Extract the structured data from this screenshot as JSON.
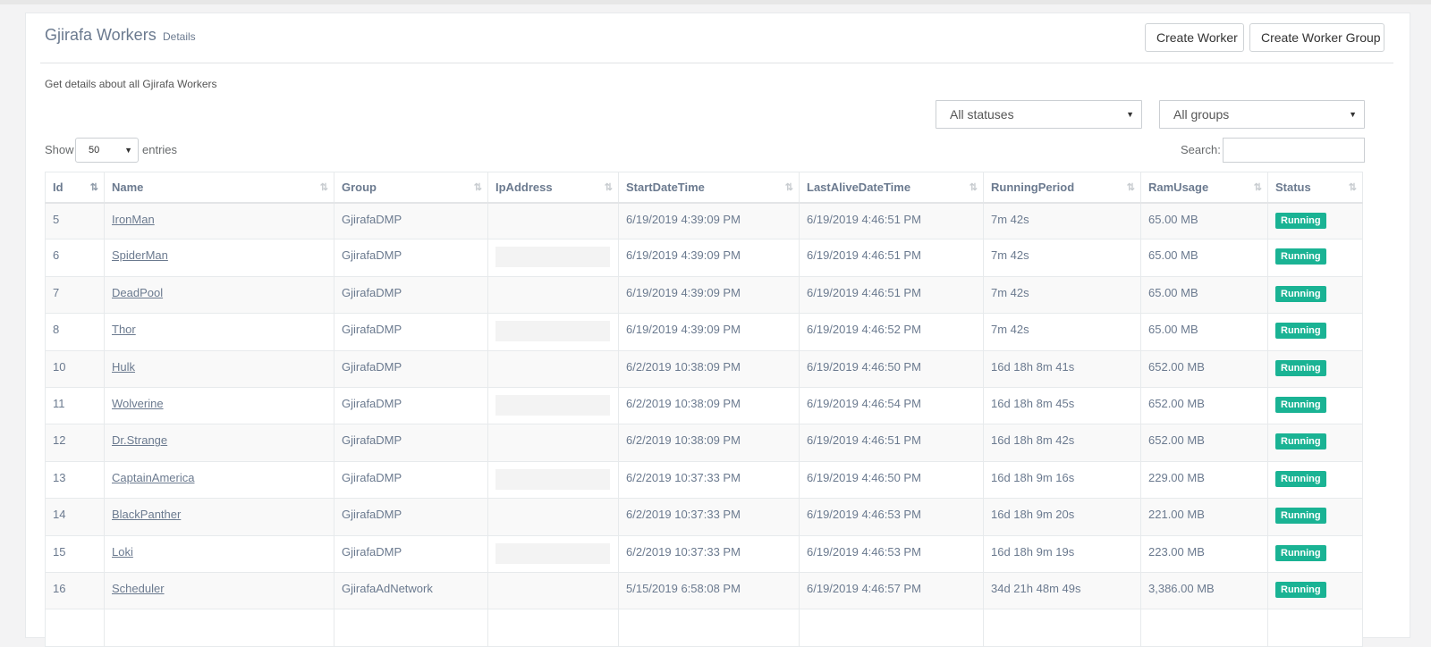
{
  "header": {
    "title": "Gjirafa Workers",
    "subtitle": "Details",
    "create_worker": "Create Worker",
    "create_worker_group": "Create Worker Group"
  },
  "description": "Get details about all Gjirafa Workers",
  "filters": {
    "status": "All statuses",
    "groups": "All groups"
  },
  "table_controls": {
    "show_label": "Show",
    "entries_value": "50",
    "entries_label": "entries",
    "search_label": "Search:",
    "search_value": ""
  },
  "columns": [
    "Id",
    "Name",
    "Group",
    "IpAddress",
    "StartDateTime",
    "LastAliveDateTime",
    "RunningPeriod",
    "RamUsage",
    "Status"
  ],
  "rows": [
    {
      "id": "5",
      "name": "IronMan",
      "group": "GjirafaDMP",
      "ip": "",
      "ip_redacted": false,
      "start": "6/19/2019 4:39:09 PM",
      "last_alive": "6/19/2019 4:46:51 PM",
      "period": "7m 42s",
      "ram": "65.00 MB",
      "status": "Running"
    },
    {
      "id": "6",
      "name": "SpiderMan",
      "group": "GjirafaDMP",
      "ip": "",
      "ip_redacted": true,
      "start": "6/19/2019 4:39:09 PM",
      "last_alive": "6/19/2019 4:46:51 PM",
      "period": "7m 42s",
      "ram": "65.00 MB",
      "status": "Running"
    },
    {
      "id": "7",
      "name": "DeadPool",
      "group": "GjirafaDMP",
      "ip": "",
      "ip_redacted": false,
      "start": "6/19/2019 4:39:09 PM",
      "last_alive": "6/19/2019 4:46:51 PM",
      "period": "7m 42s",
      "ram": "65.00 MB",
      "status": "Running"
    },
    {
      "id": "8",
      "name": "Thor",
      "group": "GjirafaDMP",
      "ip": "",
      "ip_redacted": true,
      "start": "6/19/2019 4:39:09 PM",
      "last_alive": "6/19/2019 4:46:52 PM",
      "period": "7m 42s",
      "ram": "65.00 MB",
      "status": "Running"
    },
    {
      "id": "10",
      "name": "Hulk",
      "group": "GjirafaDMP",
      "ip": "",
      "ip_redacted": false,
      "start": "6/2/2019 10:38:09 PM",
      "last_alive": "6/19/2019 4:46:50 PM",
      "period": "16d 18h 8m 41s",
      "ram": "652.00 MB",
      "status": "Running"
    },
    {
      "id": "11",
      "name": "Wolverine",
      "group": "GjirafaDMP",
      "ip": "",
      "ip_redacted": true,
      "start": "6/2/2019 10:38:09 PM",
      "last_alive": "6/19/2019 4:46:54 PM",
      "period": "16d 18h 8m 45s",
      "ram": "652.00 MB",
      "status": "Running"
    },
    {
      "id": "12",
      "name": "Dr.Strange",
      "group": "GjirafaDMP",
      "ip": "",
      "ip_redacted": false,
      "start": "6/2/2019 10:38:09 PM",
      "last_alive": "6/19/2019 4:46:51 PM",
      "period": "16d 18h 8m 42s",
      "ram": "652.00 MB",
      "status": "Running"
    },
    {
      "id": "13",
      "name": "CaptainAmerica",
      "group": "GjirafaDMP",
      "ip": "",
      "ip_redacted": true,
      "start": "6/2/2019 10:37:33 PM",
      "last_alive": "6/19/2019 4:46:50 PM",
      "period": "16d 18h 9m 16s",
      "ram": "229.00 MB",
      "status": "Running"
    },
    {
      "id": "14",
      "name": "BlackPanther",
      "group": "GjirafaDMP",
      "ip": "",
      "ip_redacted": false,
      "start": "6/2/2019 10:37:33 PM",
      "last_alive": "6/19/2019 4:46:53 PM",
      "period": "16d 18h 9m 20s",
      "ram": "221.00 MB",
      "status": "Running"
    },
    {
      "id": "15",
      "name": "Loki",
      "group": "GjirafaDMP",
      "ip": "",
      "ip_redacted": true,
      "start": "6/2/2019 10:37:33 PM",
      "last_alive": "6/19/2019 4:46:53 PM",
      "period": "16d 18h 9m 19s",
      "ram": "223.00 MB",
      "status": "Running"
    },
    {
      "id": "16",
      "name": "Scheduler",
      "group": "GjirafaAdNetwork",
      "ip": "",
      "ip_redacted": false,
      "start": "5/15/2019 6:58:08 PM",
      "last_alive": "6/19/2019 4:46:57 PM",
      "period": "34d 21h 48m 49s",
      "ram": "3,386.00 MB",
      "status": "Running"
    },
    {
      "id": "",
      "name": "",
      "group": "",
      "ip": "",
      "ip_redacted": false,
      "start": "",
      "last_alive": "",
      "period": "",
      "ram": "",
      "status": ""
    }
  ],
  "colors": {
    "status_running": "#1ab394",
    "text": "#6b7a8f"
  }
}
